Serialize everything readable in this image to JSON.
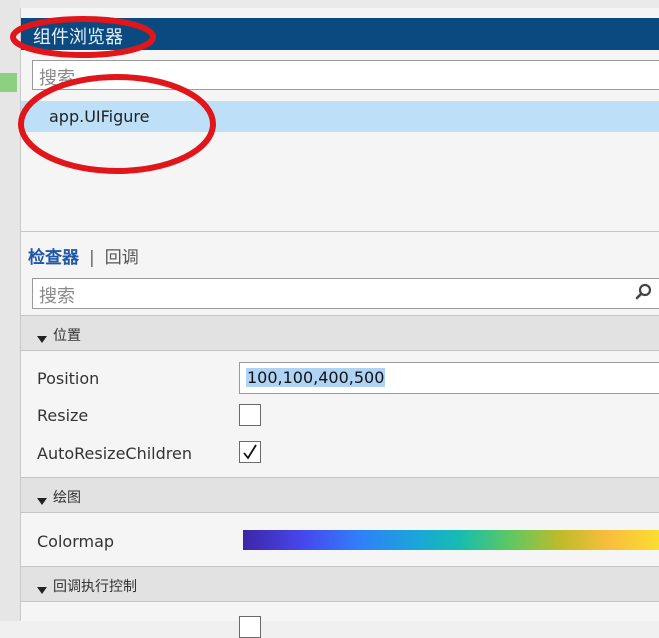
{
  "component_browser": {
    "title": "组件浏览器",
    "search_placeholder": "搜索",
    "tree": [
      {
        "label": "app.UIFigure",
        "selected": true
      }
    ]
  },
  "inspector": {
    "tabs": [
      {
        "label": "检查器",
        "active": true
      },
      {
        "label": "回调",
        "active": false
      }
    ],
    "search_placeholder": "搜索",
    "sections": [
      {
        "label": "位置",
        "expanded": true,
        "properties": [
          {
            "name": "Position",
            "value": "100,100,400,500"
          },
          {
            "name": "Resize",
            "checked": false
          },
          {
            "name": "AutoResizeChildren",
            "checked": true
          }
        ]
      },
      {
        "label": "绘图",
        "expanded": true,
        "properties": [
          {
            "name": "Colormap"
          }
        ]
      },
      {
        "label": "回调执行控制",
        "expanded": true
      }
    ]
  },
  "colors": {
    "title_bar": "#0a4a80",
    "selection": "#bde0f8",
    "active_tab": "#2057a6",
    "annotation": "#e0161b"
  }
}
